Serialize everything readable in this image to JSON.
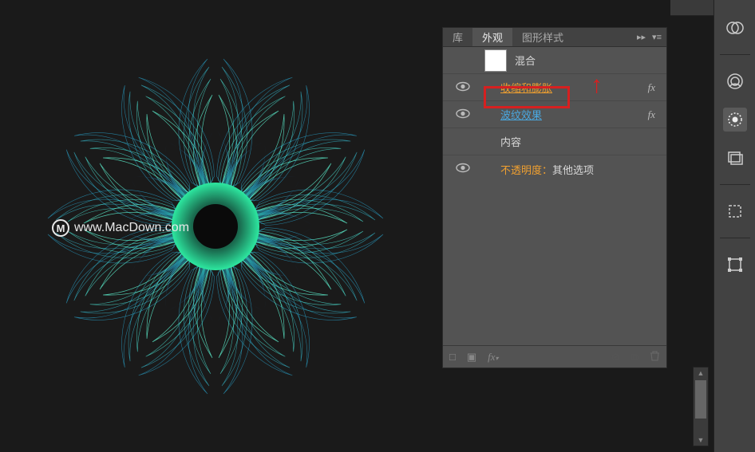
{
  "watermark": {
    "text": "www.MacDown.com",
    "icon_letter": "M"
  },
  "panel": {
    "tabs": [
      {
        "label": "库",
        "active": false
      },
      {
        "label": "外观",
        "active": true
      },
      {
        "label": "图形样式",
        "active": false
      }
    ],
    "rows": {
      "blend": {
        "label": "混合"
      },
      "effect1": {
        "label": "收缩和膨胀",
        "fx": "fx"
      },
      "effect2": {
        "label": "波纹效果",
        "fx": "fx"
      },
      "content": {
        "label": "内容"
      },
      "opacity": {
        "prefix": "不透明度：",
        "suffix": "其他选项"
      }
    },
    "bottom_icons": {
      "stroke": "□",
      "fill": "■",
      "fx": "fx",
      "disabled1": "⊘",
      "dup": "⧉",
      "trash": "🗑"
    }
  },
  "dock": {
    "icons": [
      {
        "name": "blend-icon"
      },
      {
        "name": "cc-libraries-icon"
      },
      {
        "name": "appearance-icon",
        "active": true
      },
      {
        "name": "graphic-styles-icon"
      },
      {
        "name": "artboard-icon"
      },
      {
        "name": "transform-icon"
      }
    ]
  }
}
